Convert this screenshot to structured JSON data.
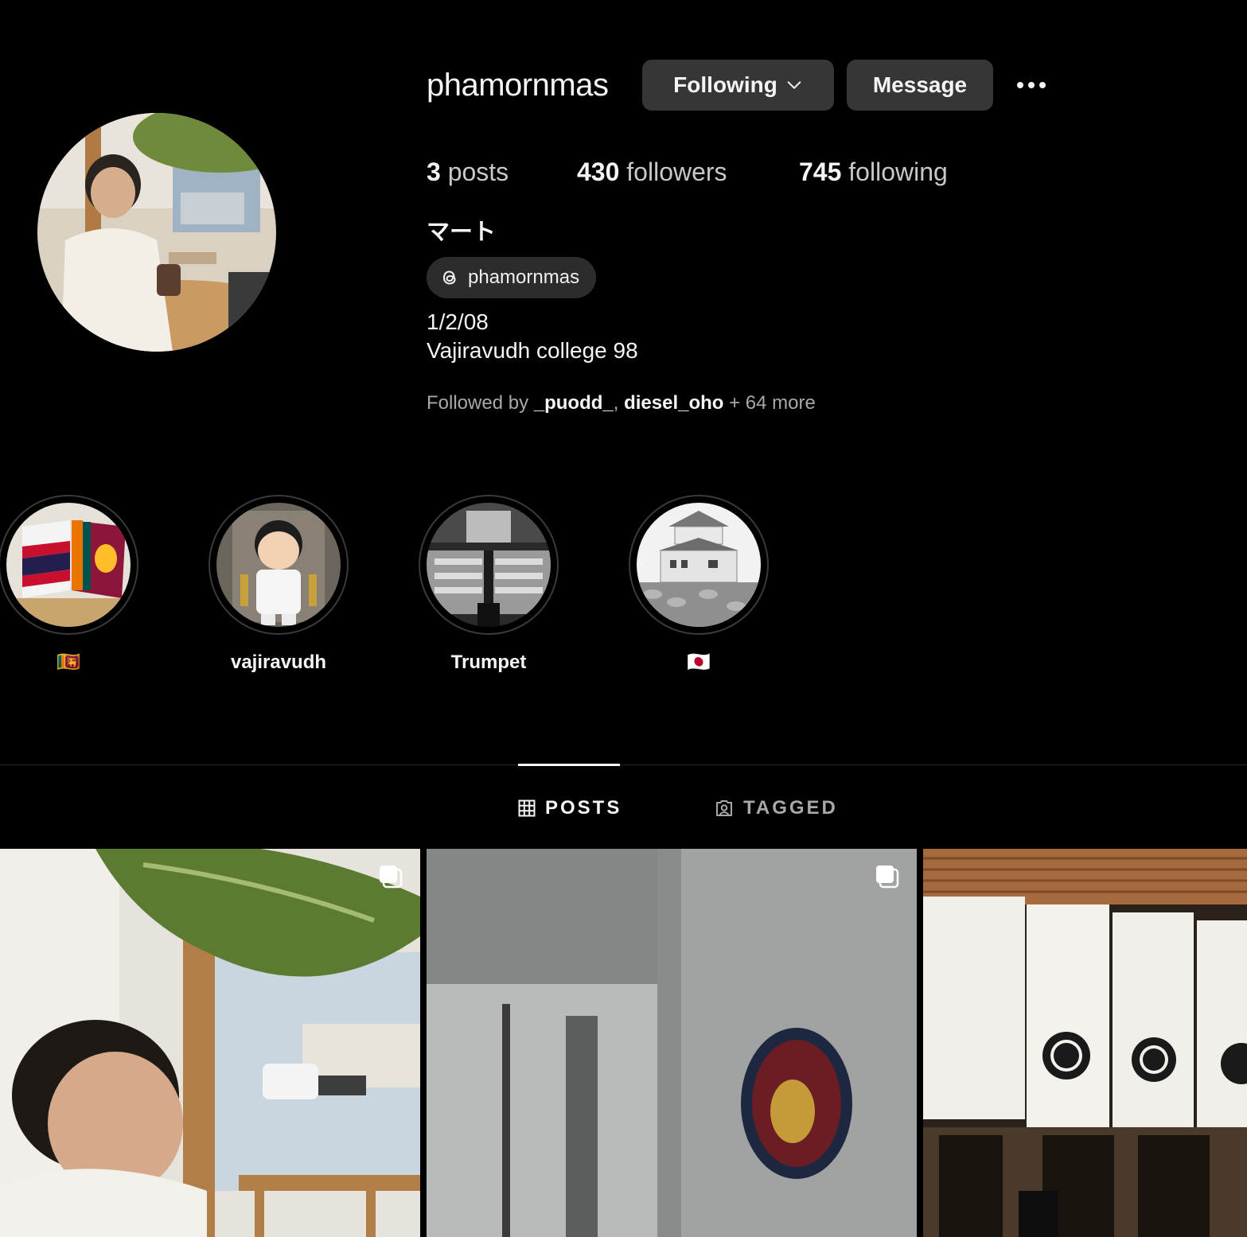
{
  "profile": {
    "username": "phamornmas",
    "following_button": "Following",
    "message_button": "Message",
    "stats": {
      "posts_count": "3",
      "posts_label": "posts",
      "followers_count": "430",
      "followers_label": "followers",
      "following_count": "745",
      "following_label": "following"
    },
    "full_name": "マート",
    "threads_handle": "phamornmas",
    "bio_line1": "1/2/08",
    "bio_line2": "Vajiravudh college 98",
    "followed_by_prefix": "Followed by",
    "followed_by_user1": "_puodd_",
    "followed_by_sep": ",",
    "followed_by_user2": "diesel_oho",
    "followed_by_suffix": "+ 64 more"
  },
  "highlights": [
    {
      "label": "🇱🇰"
    },
    {
      "label": "vajiravudh"
    },
    {
      "label": "Trumpet"
    },
    {
      "label": "🇯🇵"
    }
  ],
  "tabs": {
    "posts": "POSTS",
    "tagged": "TAGGED"
  },
  "colors": {
    "background": "#000000",
    "button": "#363636",
    "secondary_text": "#a8a8a8"
  }
}
